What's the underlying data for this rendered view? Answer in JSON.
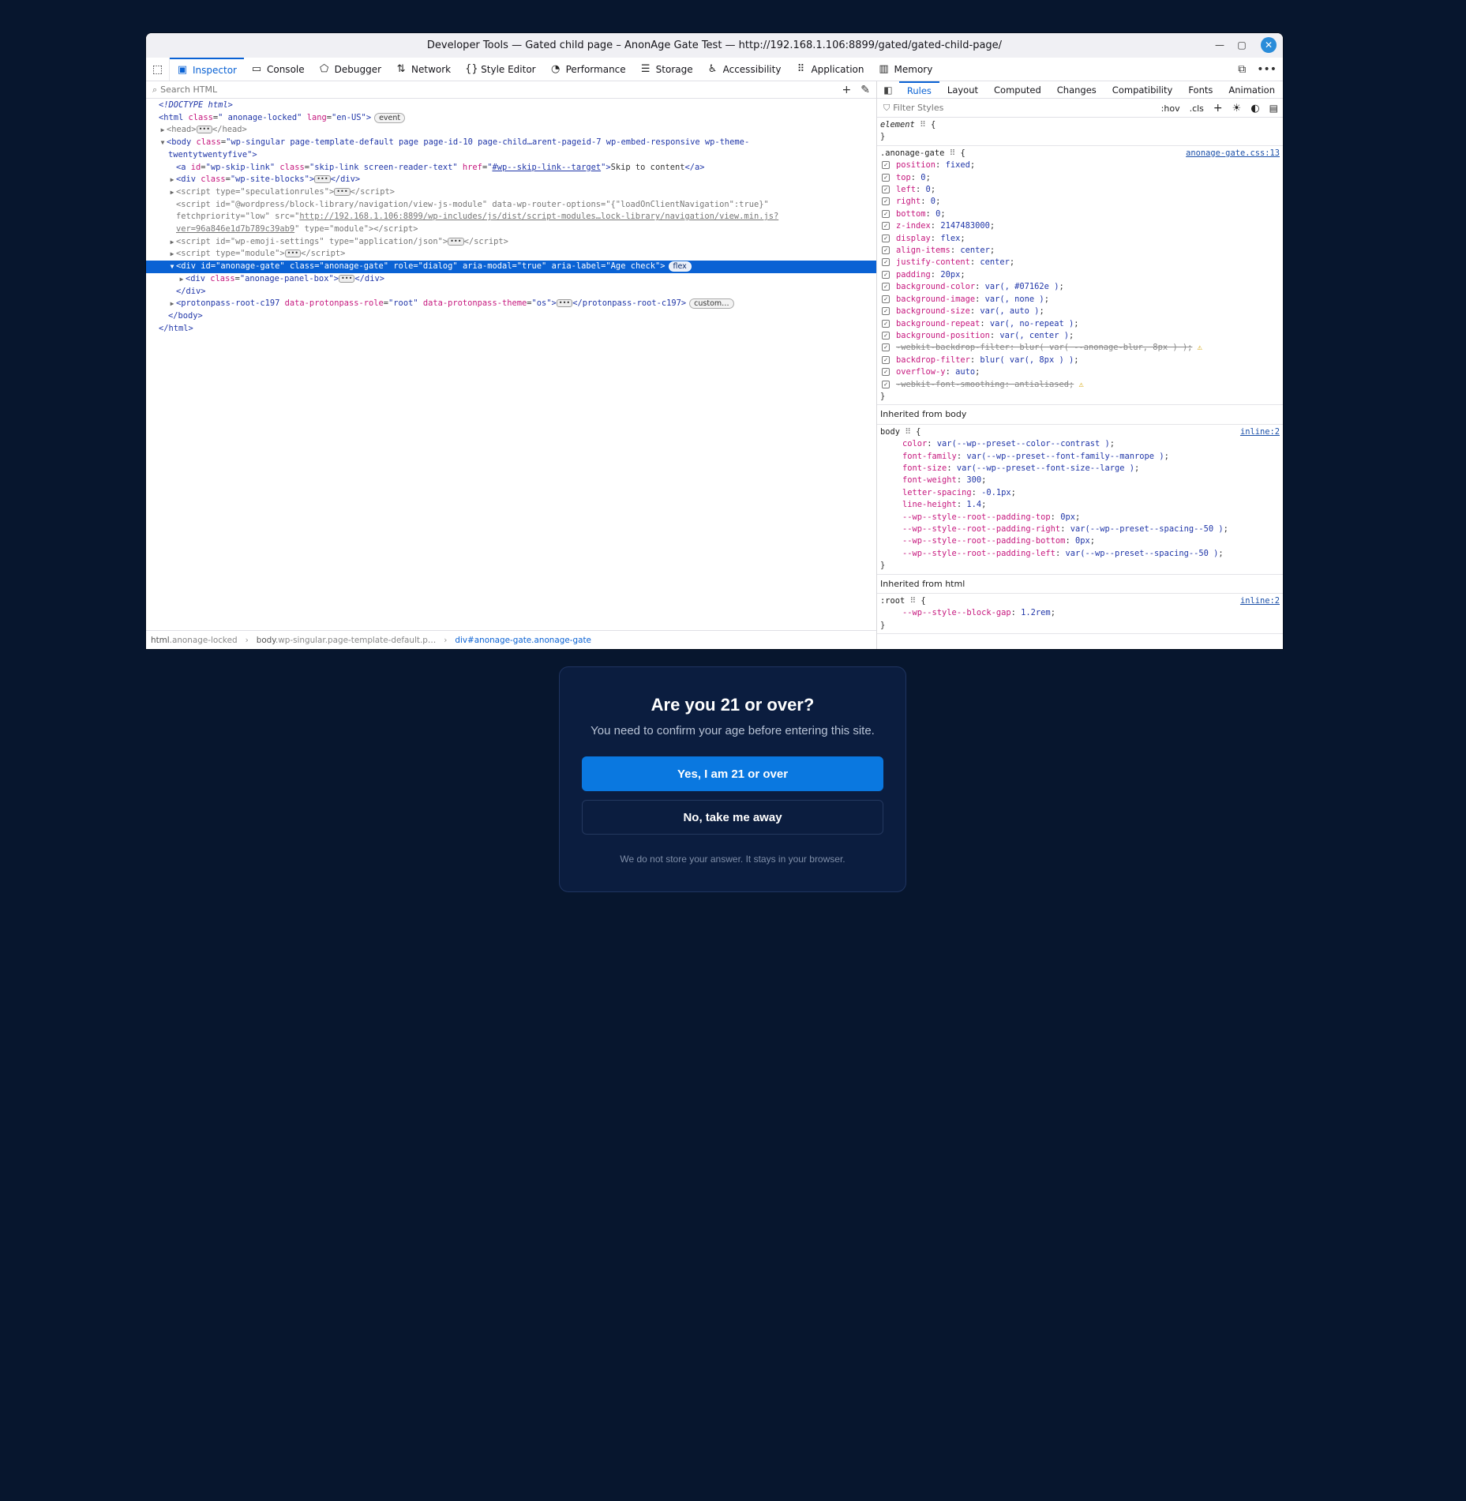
{
  "window": {
    "title": "Developer Tools — Gated child page – AnonAge Gate Test — http://192.168.1.106:8899/gated/gated-child-page/"
  },
  "toolbar": {
    "tabs": [
      {
        "label": "Inspector",
        "icon": "inspector-icon"
      },
      {
        "label": "Console",
        "icon": "console-icon"
      },
      {
        "label": "Debugger",
        "icon": "debugger-icon"
      },
      {
        "label": "Network",
        "icon": "network-icon"
      },
      {
        "label": "Style Editor",
        "icon": "braces-icon"
      },
      {
        "label": "Performance",
        "icon": "gauge-icon"
      },
      {
        "label": "Storage",
        "icon": "storage-icon"
      },
      {
        "label": "Accessibility",
        "icon": "accessibility-icon"
      },
      {
        "label": "Application",
        "icon": "grid-icon"
      },
      {
        "label": "Memory",
        "icon": "memory-icon"
      }
    ]
  },
  "markup": {
    "search_placeholder": "Search HTML",
    "lines": {
      "doctype": "<!DOCTYPE html>",
      "html_class": "\" anonage-locked\"",
      "html_lang": "\"en-US\"",
      "event_badge": "event",
      "head": "head",
      "body_class": "\"wp-singular page-template-default page page-id-10 page-child…arent-pageid-7 wp-embed-responsive wp-theme-",
      "body_class2": "twentytwentyfive\"",
      "a_id": "\"wp-skip-link\"",
      "a_class": "\"skip-link screen-reader-text\"",
      "a_href": "#wp--skip-link--target",
      "a_text": "Skip to content",
      "div_sb_class": "\"wp-site-blocks\"",
      "script1_type": "speculationrules",
      "script2_id": "\"@wordpress/block-library/navigation/view-js-module\"",
      "script2_opts": "\"{\"loadOnClientNavigation\":true}\"",
      "script2_fp": "\"low\"",
      "script2_src": "http://192.168.1.106:8899/wp-includes/js/dist/script-modules…lock-library/navigation/view.min.js?",
      "script2_src2": "ver=96a846e1d7b789c39ab9",
      "script2_type": "\"module\"",
      "script3_id": "\"wp-emoji-settings\"",
      "script3_type": "\"application/json\"",
      "script4_type": "\"module\"",
      "gate_id": "\"anonage-gate\"",
      "gate_class": "\"anonage-gate\"",
      "gate_role": "\"dialog\"",
      "gate_modal": "\"true\"",
      "gate_label": "\"Age check\"",
      "flex_badge": "flex",
      "panel_class": "\"anonage-panel-box\"",
      "pp_tag": "protonpass-root-c197",
      "pp_role": "\"root\"",
      "pp_theme": "\"os\"",
      "custom_badge": "custom…"
    },
    "breadcrumbs": [
      {
        "tag": "html",
        "cls": ".anonage-locked"
      },
      {
        "tag": "body",
        "cls": ".wp-singular.page-template-default.p…"
      },
      {
        "tag": "div",
        "cls": "#anonage-gate.anonage-gate"
      }
    ]
  },
  "rules": {
    "tabs": [
      "Rules",
      "Layout",
      "Computed",
      "Changes",
      "Compatibility",
      "Fonts",
      "Animation"
    ],
    "filter_placeholder": "Filter Styles",
    "hov": ":hov",
    "cls": ".cls",
    "element_selector": "element",
    "gate_selector": ".anonage-gate",
    "gate_source": "anonage-gate.css:13",
    "gate_decls": [
      {
        "p": "position",
        "v": "fixed"
      },
      {
        "p": "top",
        "v": "0"
      },
      {
        "p": "left",
        "v": "0"
      },
      {
        "p": "right",
        "v": "0"
      },
      {
        "p": "bottom",
        "v": "0"
      },
      {
        "p": "z-index",
        "v": "2147483000"
      },
      {
        "p": "display",
        "v": "flex"
      },
      {
        "p": "align-items",
        "v": "center"
      },
      {
        "p": "justify-content",
        "v": "center"
      },
      {
        "p": "padding",
        "v": "20px"
      },
      {
        "p": "background-color",
        "v": "var(, #07162e )"
      },
      {
        "p": "background-image",
        "v": "var(, none )"
      },
      {
        "p": "background-size",
        "v": "var(, auto )"
      },
      {
        "p": "background-repeat",
        "v": "var(, no-repeat )"
      },
      {
        "p": "background-position",
        "v": "var(, center )"
      },
      {
        "p": "-webkit-backdrop-filter",
        "v": "blur( var( --anonage-blur, 8px ) )",
        "strike": true,
        "warn": true
      },
      {
        "p": "backdrop-filter",
        "v": "blur( var(, 8px ) )"
      },
      {
        "p": "overflow-y",
        "v": "auto"
      },
      {
        "p": "-webkit-font-smoothing",
        "v": "antialiased",
        "strike": true,
        "warn": true
      }
    ],
    "inh_body_header": "Inherited from body",
    "body_selector": "body",
    "body_source": "inline:2",
    "body_decls": [
      {
        "p": "color",
        "v": "var(--wp--preset--color--contrast )"
      },
      {
        "p": "font-family",
        "v": "var(--wp--preset--font-family--manrope )"
      },
      {
        "p": "font-size",
        "v": "var(--wp--preset--font-size--large )"
      },
      {
        "p": "font-weight",
        "v": "300"
      },
      {
        "p": "letter-spacing",
        "v": "-0.1px"
      },
      {
        "p": "line-height",
        "v": "1.4"
      },
      {
        "p": "--wp--style--root--padding-top",
        "v": "0px"
      },
      {
        "p": "--wp--style--root--padding-right",
        "v": "var(--wp--preset--spacing--50 )"
      },
      {
        "p": "--wp--style--root--padding-bottom",
        "v": "0px"
      },
      {
        "p": "--wp--style--root--padding-left",
        "v": "var(--wp--preset--spacing--50 )"
      }
    ],
    "inh_html_header": "Inherited from html",
    "root_selector": ":root",
    "root_source": "inline:2",
    "root_decls": [
      {
        "p": "--wp--style--block-gap",
        "v": "1.2rem"
      }
    ]
  },
  "gate": {
    "title": "Are you 21 or over?",
    "subtitle": "You need to confirm your age before entering this site.",
    "yes_label": "Yes, I am 21 or over",
    "no_label": "No, take me away",
    "note": "We do not store your answer. It stays in your browser."
  },
  "colors": {
    "page_bg": "#07162e",
    "accent": "#0a62d4",
    "yes_button": "#0a78e0"
  }
}
